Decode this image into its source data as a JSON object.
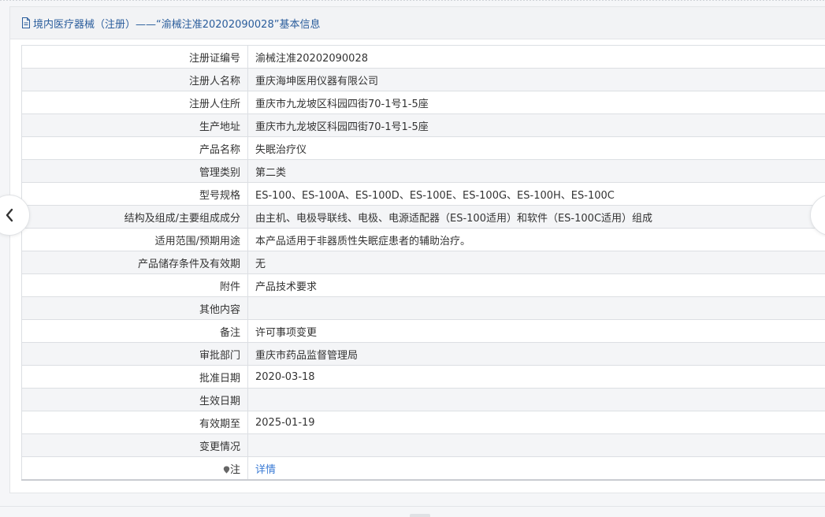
{
  "header": {
    "title": "境内医疗器械（注册）——“渝械注准20202090028”基本信息"
  },
  "rows": [
    {
      "label": "注册证编号",
      "value": "渝械注准20202090028"
    },
    {
      "label": "注册人名称",
      "value": "重庆海坤医用仪器有限公司"
    },
    {
      "label": "注册人住所",
      "value": "重庆市九龙坡区科园四街70-1号1-5座"
    },
    {
      "label": "生产地址",
      "value": "重庆市九龙坡区科园四街70-1号1-5座"
    },
    {
      "label": "产品名称",
      "value": "失眠治疗仪"
    },
    {
      "label": "管理类别",
      "value": "第二类"
    },
    {
      "label": "型号规格",
      "value": "ES-100、ES-100A、ES-100D、ES-100E、ES-100G、ES-100H、ES-100C"
    },
    {
      "label": "结构及组成/主要组成成分",
      "value": "由主机、电极导联线、电极、电源适配器（ES-100适用）和软件（ES-100C适用）组成"
    },
    {
      "label": "适用范围/预期用途",
      "value": "本产品适用于非器质性失眠症患者的辅助治疗。"
    },
    {
      "label": "产品储存条件及有效期",
      "value": "无"
    },
    {
      "label": "附件",
      "value": "产品技术要求"
    },
    {
      "label": "其他内容",
      "value": ""
    },
    {
      "label": "备注",
      "value": "许可事项变更"
    },
    {
      "label": "审批部门",
      "value": "重庆市药品监督管理局"
    },
    {
      "label": "批准日期",
      "value": "2020-03-18"
    },
    {
      "label": "生效日期",
      "value": ""
    },
    {
      "label": "有效期至",
      "value": "2025-01-19"
    },
    {
      "label": "变更情况",
      "value": ""
    }
  ],
  "note_row": {
    "label": "注",
    "link": "详情"
  },
  "nav": {
    "prev_icon": "chevron-left-icon",
    "next_icon": "chevron-right-icon"
  },
  "colors": {
    "accent": "#2a5d9c",
    "link": "#3a7bd5"
  }
}
